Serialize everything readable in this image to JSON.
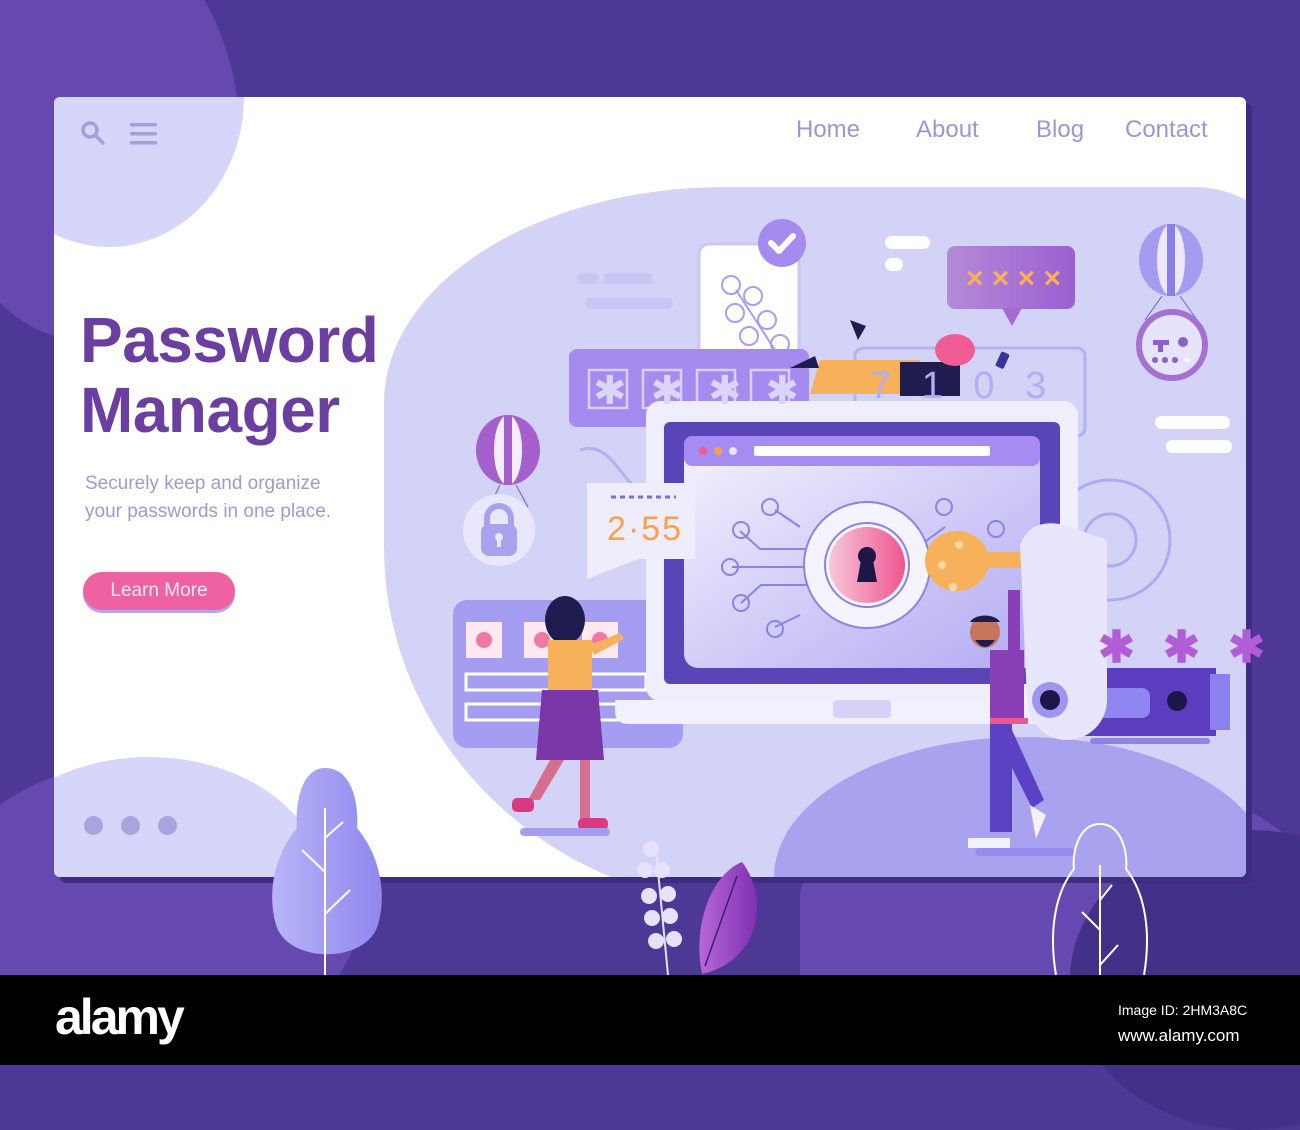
{
  "header": {
    "search_icon": "search-icon",
    "menu_icon": "hamburger-menu-icon",
    "nav": [
      {
        "label": "Home"
      },
      {
        "label": "About"
      },
      {
        "label": "Blog"
      },
      {
        "label": "Contact"
      }
    ]
  },
  "hero": {
    "title_line1": "Password",
    "title_line2": "Manager",
    "subtitle_line1": "Securely keep and organize",
    "subtitle_line2": "your passwords in one place.",
    "cta_label": "Learn More",
    "pagination_dots": 3
  },
  "illustration": {
    "pin_masks": [
      "✱",
      "✱",
      "✱",
      "✱"
    ],
    "speech_bubble_text": "× × × ×",
    "code_digits": "7 1 0 3",
    "timer": "2·55",
    "password_stars": "✱ ✱ ✱",
    "icons": [
      "checkmark-icon",
      "padlock-icon",
      "keyhole-icon",
      "key-icon",
      "gear-icon",
      "hot-air-balloon-icon",
      "usb-drive-icon",
      "leaf-icon",
      "tree-icon"
    ]
  },
  "colors": {
    "brand_purple": "#6a3fa0",
    "nav_text": "#9997d5",
    "cta_pink": "#ee62a1",
    "background": "#4d3895",
    "accent_orange": "#f7a24b"
  },
  "watermark": {
    "logo": "alamy",
    "image_id": "Image ID: 2HM3A8C",
    "url": "www.alamy.com"
  }
}
